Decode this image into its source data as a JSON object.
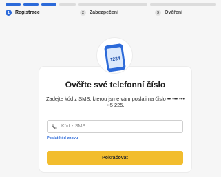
{
  "progress": {
    "segments_active": 3,
    "segments_total": 9
  },
  "steps": [
    {
      "number": "1",
      "label": "Registrace",
      "active": true
    },
    {
      "number": "2",
      "label": "Zabezpečení",
      "active": false
    },
    {
      "number": "3",
      "label": "Ověření",
      "active": false
    }
  ],
  "illustration": {
    "icon": "phone-icon",
    "screen_code": "1234"
  },
  "card": {
    "title": "Ověřte své telefonní číslo",
    "description": "Zadejte kód z SMS, kterou jsme vám poslali na číslo •• ••• ••• ••5 225.",
    "input_placeholder": "Kód z SMS",
    "input_value": "",
    "resend_link": "Poslat kód znovu",
    "submit_button": "Pokračovat"
  },
  "colors": {
    "accent": "#2c6ad9",
    "button": "#f2bd2e",
    "background": "#f6f6f6"
  }
}
